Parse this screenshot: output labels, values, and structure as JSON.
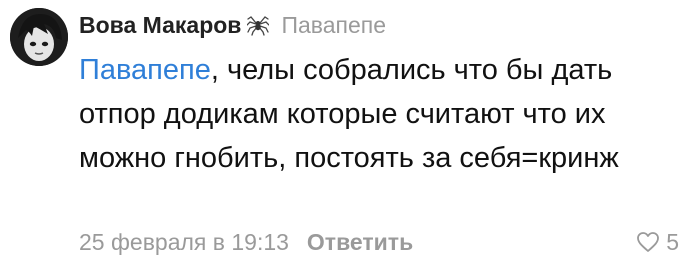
{
  "comment": {
    "author": "Вова Макаров",
    "author_badge_icon": "spider-icon",
    "reply_to": "Павапепе",
    "mention": "Павапепе",
    "text": ", челы собрались что бы дать отпор додикам которые считают что их можно гнобить, постоять за себя=кринж",
    "date": "25 февраля в 19:13",
    "reply_label": "Ответить",
    "likes_count": "5",
    "like_icon": "heart-icon"
  },
  "colors": {
    "mention": "#2f7fd8",
    "meta": "#9a9a9a",
    "text": "#111111"
  }
}
